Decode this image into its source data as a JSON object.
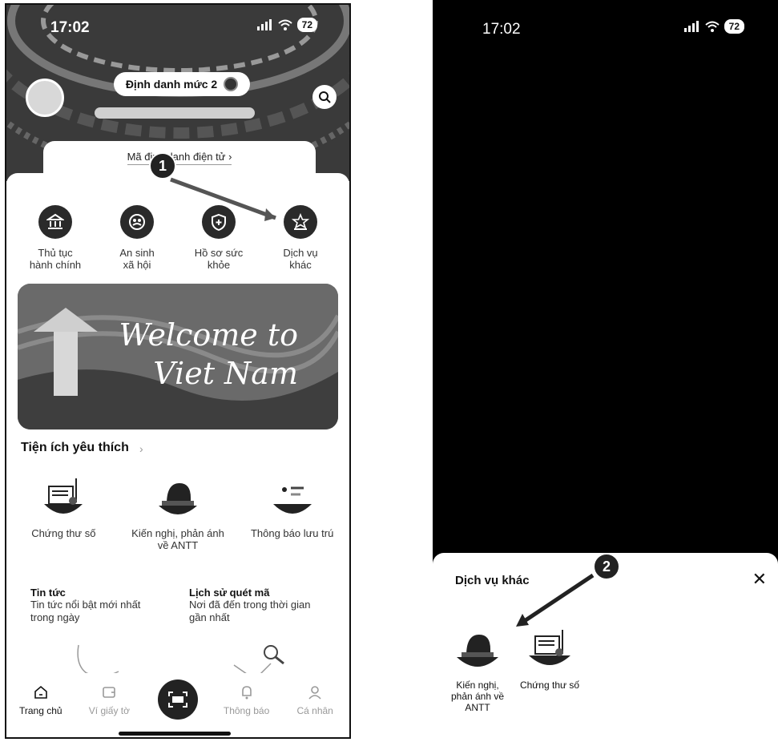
{
  "left_screen": {
    "status_bar": {
      "time": "17:02",
      "battery": "72"
    },
    "id_level_badge": "Định danh mức 2",
    "id_link": "Mã định danh điện tử",
    "quick_actions": [
      {
        "label": "Thủ tục\nhành chính",
        "icon": "bank-icon"
      },
      {
        "label": "An sinh\nxã hội",
        "icon": "family-icon"
      },
      {
        "label": "Hồ sơ sức\nkhỏe",
        "icon": "health-shield-icon"
      },
      {
        "label": "Dịch vụ\nkhác",
        "icon": "star-stand-icon"
      }
    ],
    "banner_text": "Welcome to\nViet Nam",
    "favorites_title": "Tiện ích yêu thích",
    "favorites": [
      {
        "label": "Chứng thư số",
        "icon": "certificate-icon"
      },
      {
        "label": "Kiến nghị, phản ánh về ANTT",
        "icon": "police-icon"
      },
      {
        "label": "Thông báo lưu trú",
        "icon": "residence-icon"
      }
    ],
    "news": [
      {
        "title": "Tin tức",
        "desc": "Tin tức nổi bật mới nhất trong ngày"
      },
      {
        "title": "Lịch sử quét mã",
        "desc": "Nơi đã đến trong thời gian gần nhất"
      }
    ],
    "tabs": [
      {
        "label": "Trang chủ",
        "icon": "home-icon",
        "active": true
      },
      {
        "label": "Ví giấy tờ",
        "icon": "wallet-icon",
        "active": false
      },
      {
        "label": "Thông báo",
        "icon": "bell-icon",
        "active": false
      },
      {
        "label": "Cá nhân",
        "icon": "person-icon",
        "active": false
      }
    ],
    "step_marker": "1"
  },
  "right_screen": {
    "status_bar": {
      "time": "17:02",
      "battery": "72"
    },
    "sheet_title": "Dịch vụ khác",
    "sheet_items": [
      {
        "label": "Kiến nghị,\nphản ánh về\nANTT",
        "icon": "police-icon"
      },
      {
        "label": "Chứng thư số",
        "icon": "certificate-icon"
      }
    ],
    "step_marker": "2"
  }
}
